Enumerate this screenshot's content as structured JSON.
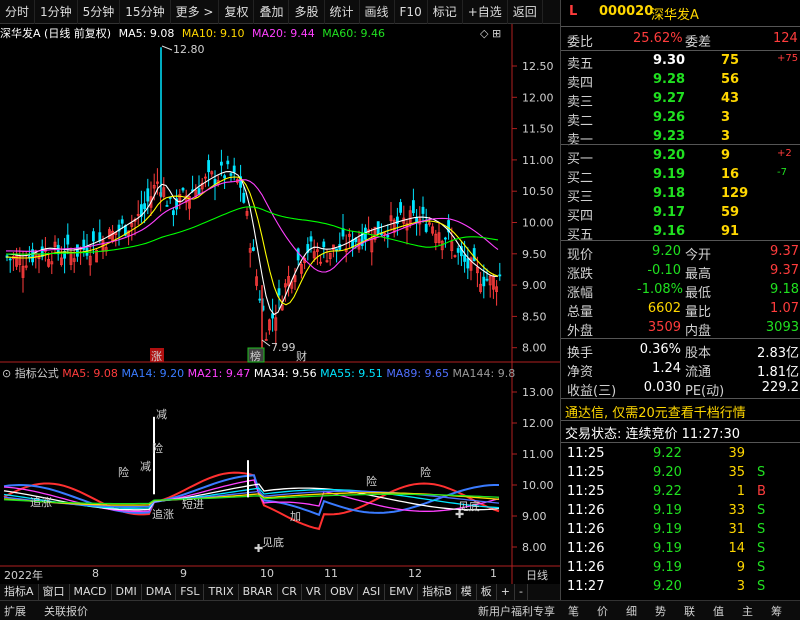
{
  "toolbar": {
    "items": [
      "分时",
      "1分钟",
      "5分钟",
      "15分钟",
      "更多 >",
      "复权",
      "叠加",
      "多股",
      "统计",
      "画线",
      "F10",
      "标记",
      "+自选",
      "返回"
    ]
  },
  "chart_header": {
    "title": "深华发A (日线 前复权)",
    "ma5": "MA5: 9.08",
    "ma10": "MA10: 9.10",
    "ma20": "MA20: 9.44",
    "ma60": "MA60: 9.46"
  },
  "indicator_header": {
    "label": "指标公式",
    "ma5": "MA5: 9.08",
    "ma14": "MA14: 9.20",
    "ma21": "MA21: 9.47",
    "ma34": "MA34: 9.56",
    "ma55": "MA55: 9.51",
    "ma89": "MA89: 9.65",
    "ma144": "MA144: 9.8"
  },
  "colors": {
    "up": "#ff3c3c",
    "down": "#00e5ff",
    "ma5": "#ffffff",
    "ma10": "#ffff00",
    "ma20": "#ff40ff",
    "ma60": "#00ff00"
  },
  "price_axis": [
    "12.50",
    "12.00",
    "11.50",
    "11.00",
    "10.50",
    "10.00",
    "9.50",
    "9.00",
    "8.50",
    "8.00"
  ],
  "indicator_axis": [
    "13.00",
    "12.00",
    "11.00",
    "10.00",
    "9.00",
    "8.00"
  ],
  "annotations": {
    "high": "12.80",
    "low": "7.99",
    "mark_zhang": "涨",
    "mark_bang": "榜",
    "mark_cai": "财"
  },
  "signals": [
    "减",
    "险",
    "减",
    "险",
    "险",
    "险",
    "加",
    "追涨",
    "短进",
    "追涨",
    "见底",
    "见底"
  ],
  "x_axis": {
    "year": "2022年",
    "months": [
      "8",
      "9",
      "10",
      "11",
      "12",
      "1"
    ],
    "period": "日线"
  },
  "tabs": [
    "指标A",
    "窗口",
    "MACD",
    "DMI",
    "DMA",
    "FSL",
    "TRIX",
    "BRAR",
    "CR",
    "VR",
    "OBV",
    "ASI",
    "EMV",
    "指标B",
    "模",
    "板",
    "+",
    "-"
  ],
  "status": {
    "left1": "扩展",
    "left2": "关联报价",
    "promo": "新用户福利专享",
    "icons": [
      "笔",
      "价",
      "细",
      "势",
      "联",
      "值",
      "主",
      "筹"
    ]
  },
  "quote": {
    "flag": "L",
    "code": "000020",
    "name": "深华发A",
    "weibi_label": "委比",
    "weibi": "25.62%",
    "weicha_label": "委差",
    "weicha": "124",
    "asks": [
      {
        "label": "卖五",
        "price": "9.30",
        "vol": "75",
        "chg": "+75"
      },
      {
        "label": "卖四",
        "price": "9.28",
        "vol": "56",
        "chg": ""
      },
      {
        "label": "卖三",
        "price": "9.27",
        "vol": "43",
        "chg": ""
      },
      {
        "label": "卖二",
        "price": "9.26",
        "vol": "3",
        "chg": ""
      },
      {
        "label": "卖一",
        "price": "9.23",
        "vol": "3",
        "chg": ""
      }
    ],
    "bids": [
      {
        "label": "买一",
        "price": "9.20",
        "vol": "9",
        "chg": "+2"
      },
      {
        "label": "买二",
        "price": "9.19",
        "vol": "16",
        "chg": "-7"
      },
      {
        "label": "买三",
        "price": "9.18",
        "vol": "129",
        "chg": ""
      },
      {
        "label": "买四",
        "price": "9.17",
        "vol": "59",
        "chg": ""
      },
      {
        "label": "买五",
        "price": "9.16",
        "vol": "91",
        "chg": ""
      }
    ],
    "stats1": [
      {
        "l1": "现价",
        "v1": "9.20",
        "l2": "今开",
        "v2": "9.37"
      },
      {
        "l1": "涨跌",
        "v1": "-0.10",
        "l2": "最高",
        "v2": "9.37"
      },
      {
        "l1": "涨幅",
        "v1": "-1.08%",
        "l2": "最低",
        "v2": "9.18"
      },
      {
        "l1": "总量",
        "v1": "6602",
        "l2": "量比",
        "v2": "1.07"
      },
      {
        "l1": "外盘",
        "v1": "3509",
        "l2": "内盘",
        "v2": "3093"
      }
    ],
    "stats2": [
      {
        "l1": "换手",
        "v1": "0.36%",
        "l2": "股本",
        "v2": "2.83亿"
      },
      {
        "l1": "净资",
        "v1": "1.24",
        "l2": "流通",
        "v2": "1.81亿"
      },
      {
        "l1": "收益(三)",
        "v1": "0.030",
        "l2": "PE(动)",
        "v2": "229.2"
      }
    ],
    "banner": "通达信, 仅需20元查看千档行情",
    "trade_status": "交易状态: 连续竞价 11:27:30",
    "ticks": [
      {
        "time": "11:25",
        "price": "9.22",
        "vol": "39",
        "side": ""
      },
      {
        "time": "11:25",
        "price": "9.20",
        "vol": "35",
        "side": "S"
      },
      {
        "time": "11:25",
        "price": "9.22",
        "vol": "1",
        "side": "B"
      },
      {
        "time": "11:26",
        "price": "9.19",
        "vol": "33",
        "side": "S"
      },
      {
        "time": "11:26",
        "price": "9.19",
        "vol": "31",
        "side": "S"
      },
      {
        "time": "11:26",
        "price": "9.19",
        "vol": "14",
        "side": "S"
      },
      {
        "time": "11:26",
        "price": "9.19",
        "vol": "9",
        "side": "S"
      },
      {
        "time": "11:27",
        "price": "9.20",
        "vol": "3",
        "side": "S"
      }
    ]
  }
}
